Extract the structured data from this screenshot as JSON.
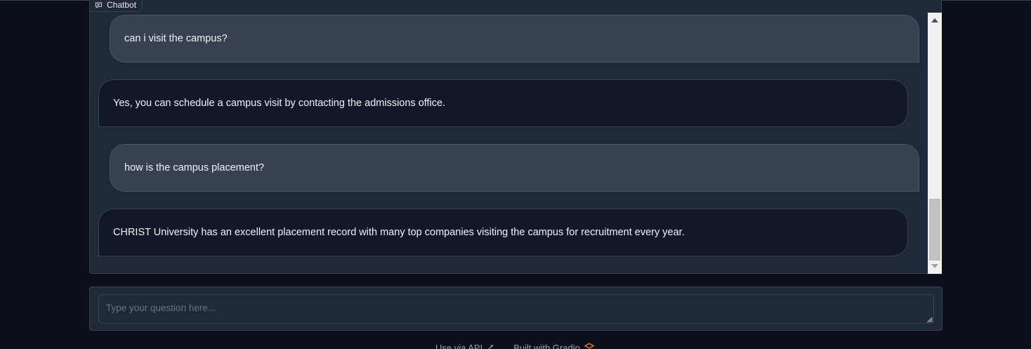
{
  "chatbot": {
    "label": "Chatbot",
    "label_icon": "chat-icon",
    "messages": [
      {
        "role": "user",
        "text": "can i visit the campus?"
      },
      {
        "role": "bot",
        "text": "Yes, you can schedule a campus visit by contacting the admissions office."
      },
      {
        "role": "user",
        "text": "how is the campus placement?"
      },
      {
        "role": "bot",
        "text": "CHRIST University has an excellent placement record with many top companies visiting the campus for recruitment every year."
      }
    ],
    "scroll_position": 1.0
  },
  "input": {
    "placeholder": "Type your question here...",
    "value": ""
  },
  "footer": {
    "api_link": "Use via API",
    "api_icon": "rocket-icon",
    "built_with": "Built with Gradio",
    "gradio_icon": "gradio-logo-icon"
  },
  "colors": {
    "page_background": "#0b0f19",
    "panel": "#1f2937",
    "user_bubble": "#374151",
    "bot_bubble": "#111827",
    "text": "#f3f4f6",
    "gradio_orange": "#f97316"
  }
}
